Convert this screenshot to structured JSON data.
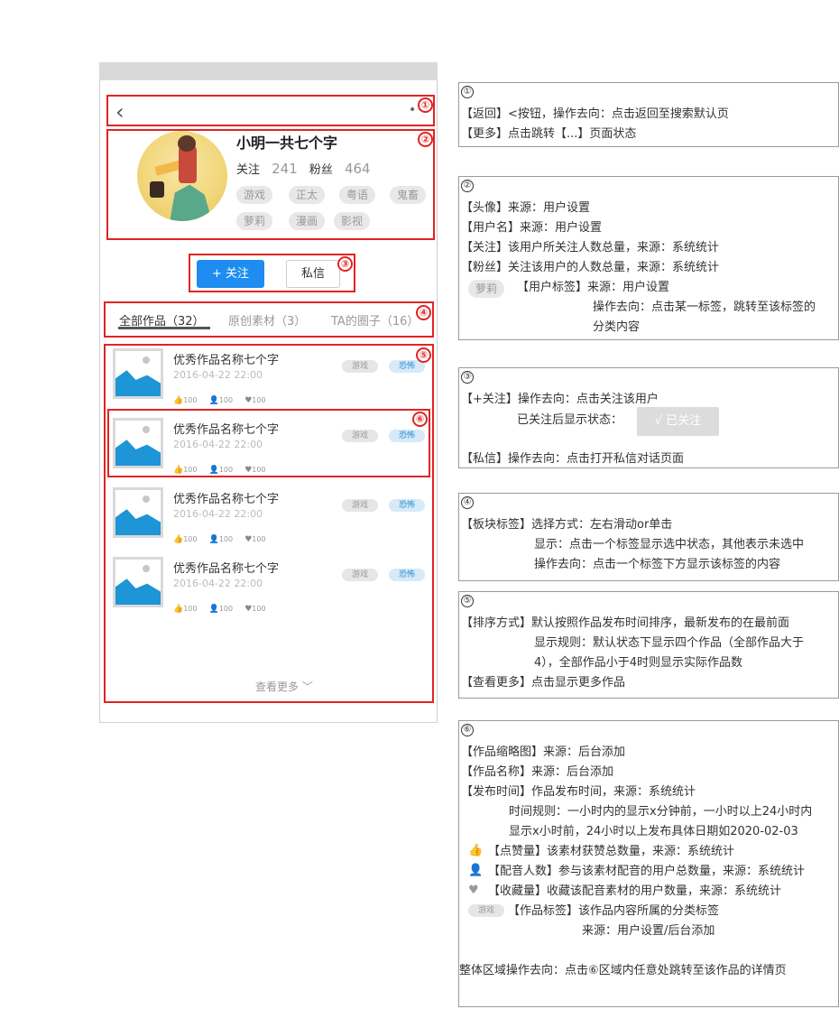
{
  "phone": {
    "back_icon": "‹",
    "more_icon": "•••",
    "profile": {
      "username": "小明一共七个字",
      "following_label": "关注",
      "following_count": "241",
      "followers_label": "粉丝",
      "followers_count": "464",
      "tags": [
        "游戏",
        "正太",
        "粤语",
        "鬼畜",
        "萝莉",
        "漫画",
        "影视"
      ]
    },
    "actions": {
      "follow": "+ 关注",
      "message": "私信"
    },
    "tabs": [
      "全部作品（32）",
      "原创素材（3）",
      "TA的圈子（16）"
    ],
    "works": [
      {
        "title": "优秀作品名称七个字",
        "date": "2016-04-22 22:00",
        "likes": "100",
        "dubbers": "100",
        "favorites": "100",
        "tag1": "游戏",
        "tag2": "恐怖"
      },
      {
        "title": "优秀作品名称七个字",
        "date": "2016-04-22 22:00",
        "likes": "100",
        "dubbers": "100",
        "favorites": "100",
        "tag1": "游戏",
        "tag2": "恐怖"
      },
      {
        "title": "优秀作品名称七个字",
        "date": "2016-04-22 22:00",
        "likes": "100",
        "dubbers": "100",
        "favorites": "100",
        "tag1": "游戏",
        "tag2": "恐怖"
      },
      {
        "title": "优秀作品名称七个字",
        "date": "2016-04-22 22:00",
        "likes": "100",
        "dubbers": "100",
        "favorites": "100",
        "tag1": "游戏",
        "tag2": "恐怖"
      }
    ],
    "see_more": "查看更多 ﹀",
    "markers": [
      "①",
      "②",
      "③",
      "④",
      "⑤",
      "⑥"
    ]
  },
  "notes": {
    "n1": {
      "mark": "①",
      "lines": [
        "【返回】<按钮，操作去向：点击返回至搜索默认页",
        "【更多】点击跳转【...】页面状态"
      ]
    },
    "n2": {
      "mark": "②",
      "lines": [
        "【头像】来源：用户设置",
        "【用户名】来源：用户设置",
        "【关注】该用户所关注人数总量，来源：系统统计",
        "【粉丝】关注该用户的人数总量，来源：系统统计"
      ],
      "tag_sample": "萝莉",
      "tag_line": "【用户标签】来源：用户设置",
      "tag_line2": "操作去向：点击某一标签，跳转至该标签的",
      "tag_line3": "分类内容"
    },
    "n3": {
      "mark": "③",
      "line1": "【+关注】操作去向：点击关注该用户",
      "line2": "已关注后显示状态：",
      "followed_btn": "√ 已关注",
      "line3": "【私信】操作去向：点击打开私信对话页面"
    },
    "n4": {
      "mark": "④",
      "lines": [
        "【板块标签】选择方式：左右滑动or单击",
        "显示：点击一个标签显示选中状态，其他表示未选中",
        "操作去向：点击一个标签下方显示该标签的内容"
      ]
    },
    "n5": {
      "mark": "⑤",
      "lines": [
        "【排序方式】默认按照作品发布时间排序，最新发布的在最前面",
        "显示规则：默认状态下显示四个作品（全部作品大于",
        "4），全部作品小于4时则显示实际作品数",
        "【查看更多】点击显示更多作品"
      ]
    },
    "n6": {
      "mark": "⑥",
      "lines": [
        "【作品缩略图】来源：后台添加",
        "【作品名称】来源：后台添加",
        "【发布时间】作品发布时间，来源：系统统计",
        "时间规则：一小时内的显示x分钟前，一小时以上24小时内",
        "显示x小时前，24小时以上发布具体日期如2020-02-03"
      ],
      "like_line": "【点赞量】该素材获赞总数量，来源：系统统计",
      "dub_line": "【配音人数】参与该素材配音的用户总数量，来源：系统统计",
      "fav_line": "【收藏量】收藏该配音素材的用户数量，来源：系统统计",
      "tag_sample": "游戏",
      "tag_line": "【作品标签】该作品内容所属的分类标签",
      "tag_line2": "来源：用户设置/后台添加",
      "footer": "整体区域操作去向：点击⑥区域内任意处跳转至该作品的详情页"
    }
  }
}
